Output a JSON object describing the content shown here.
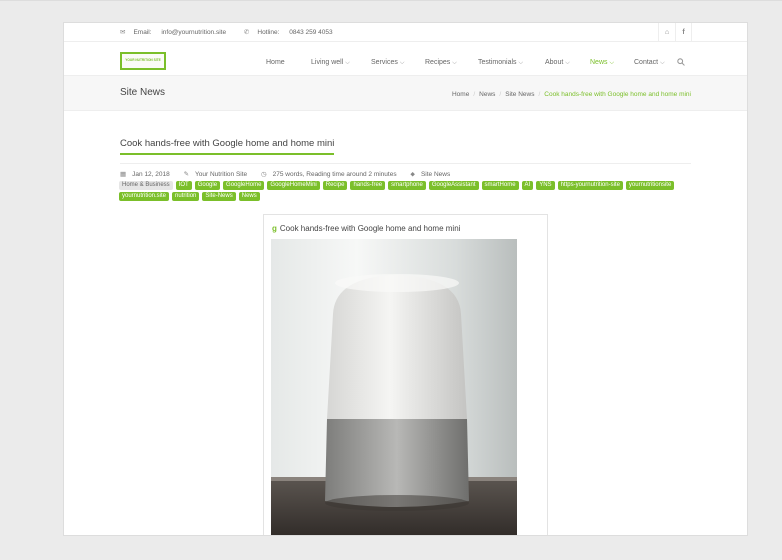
{
  "topbar": {
    "email_label": "Email:",
    "email": "info@yournutrition.site",
    "hotline_label": "Hotline:",
    "hotline": "0843 259 4053",
    "social_icons": [
      "home-icon",
      "facebook-icon"
    ]
  },
  "logo": {
    "text": "YOUR NUTRITION SITE"
  },
  "nav": {
    "items": [
      {
        "label": "Home",
        "dropdown": false,
        "active": false
      },
      {
        "label": "Living well",
        "dropdown": true,
        "active": false
      },
      {
        "label": "Services",
        "dropdown": true,
        "active": false
      },
      {
        "label": "Recipes",
        "dropdown": true,
        "active": false
      },
      {
        "label": "Testimonials",
        "dropdown": true,
        "active": false
      },
      {
        "label": "About",
        "dropdown": true,
        "active": false
      },
      {
        "label": "News",
        "dropdown": true,
        "active": true
      },
      {
        "label": "Contact",
        "dropdown": true,
        "active": false
      }
    ],
    "search_icon": "search-icon"
  },
  "page_header": {
    "title": "Site News",
    "breadcrumbs": [
      "Home",
      "News",
      "Site News",
      "Cook hands-free with Google home and home mini"
    ]
  },
  "post": {
    "title": "Cook hands-free with Google home and home mini",
    "date": "Jan 12, 2018",
    "author": "Your Nutrition Site",
    "reading": "275 words, Reading time around 2 minutes",
    "category": "Site News",
    "tags": [
      {
        "label": "Home & Business",
        "style": "grey"
      },
      {
        "label": "IOT",
        "style": "green"
      },
      {
        "label": "Google",
        "style": "green"
      },
      {
        "label": "GoogleHome",
        "style": "green"
      },
      {
        "label": "GoogleHomeMini",
        "style": "green"
      },
      {
        "label": "Recipe",
        "style": "green"
      },
      {
        "label": "hands-free",
        "style": "green"
      },
      {
        "label": "smartphone",
        "style": "green"
      },
      {
        "label": "GoogleAssistant",
        "style": "green"
      },
      {
        "label": "smartHome",
        "style": "green"
      },
      {
        "label": "AI",
        "style": "green"
      },
      {
        "label": "YNS",
        "style": "green"
      },
      {
        "label": "https-yournutrition-site",
        "style": "green"
      },
      {
        "label": "yournutritionsite",
        "style": "green"
      },
      {
        "label": "yournutrition.site",
        "style": "green"
      },
      {
        "label": "nutrition",
        "style": "green"
      },
      {
        "label": "Site-News",
        "style": "green"
      },
      {
        "label": "News",
        "style": "green"
      }
    ],
    "card_title": "Cook hands-free with Google home and home mini",
    "card_icon": "google-icon",
    "image_alt": "Google Home smart speaker"
  },
  "colors": {
    "accent": "#7bbf2a"
  }
}
